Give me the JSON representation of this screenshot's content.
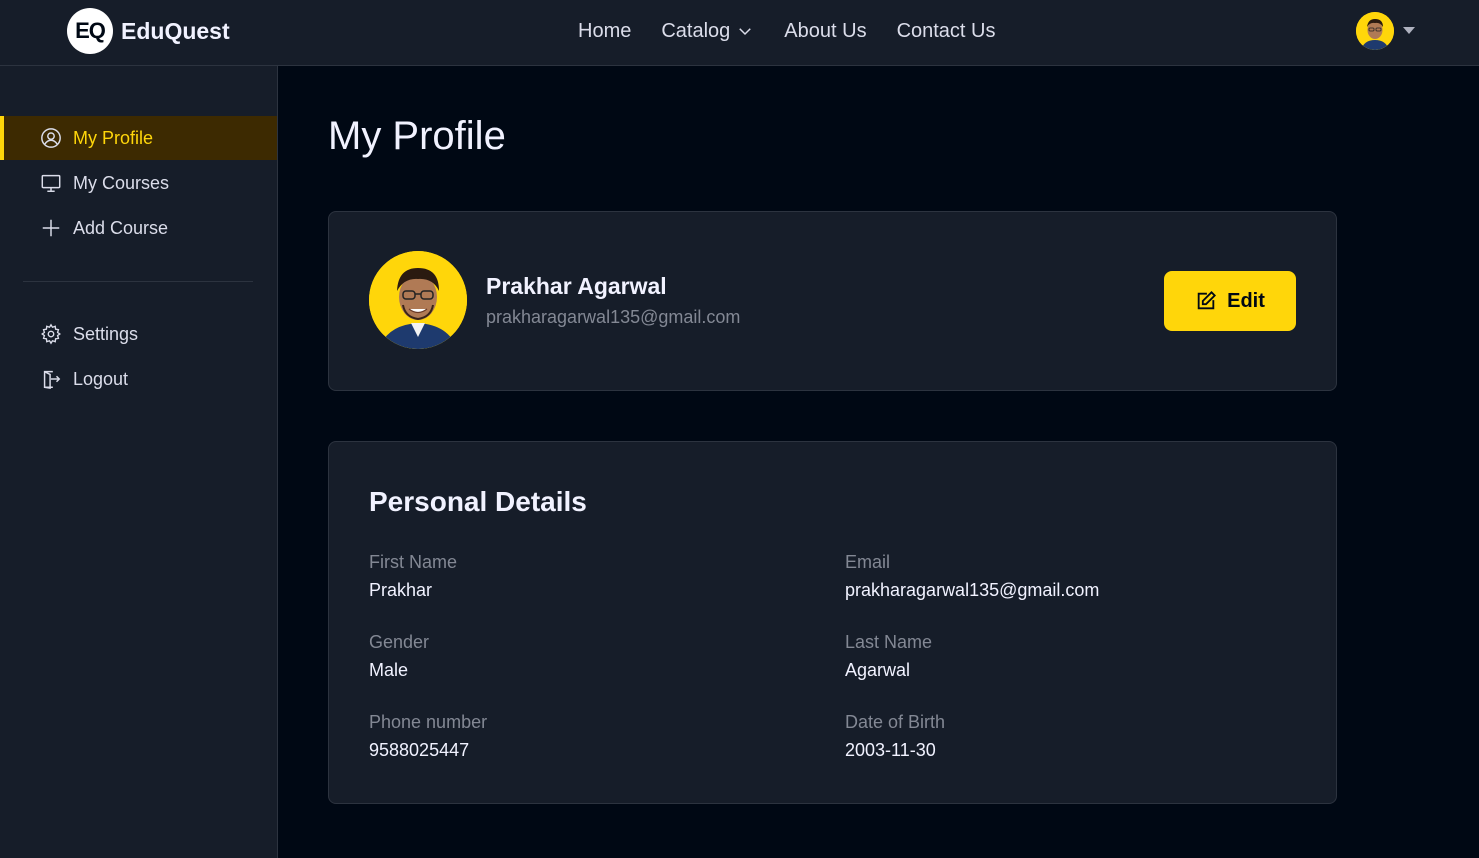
{
  "brand": {
    "logo_mark": "EQ",
    "name": "EduQuest"
  },
  "nav": {
    "links": [
      "Home",
      "Catalog",
      "About Us",
      "Contact Us"
    ],
    "catalog_icon": "chevron-down-icon",
    "avatar_icon": "user-avatar",
    "avatar_menu_icon": "caret-down-icon"
  },
  "sidebar": {
    "items": [
      {
        "label": "My Profile",
        "icon": "user-circle-icon",
        "active": true
      },
      {
        "label": "My Courses",
        "icon": "monitor-icon",
        "active": false
      },
      {
        "label": "Add Course",
        "icon": "plus-icon",
        "active": false
      }
    ],
    "bottom_items": [
      {
        "label": "Settings",
        "icon": "gear-icon"
      },
      {
        "label": "Logout",
        "icon": "logout-icon"
      }
    ]
  },
  "page": {
    "title": "My Profile"
  },
  "profile": {
    "name": "Prakhar Agarwal",
    "email": "prakharagarwal135@gmail.com",
    "edit_label": "Edit",
    "edit_icon": "edit-icon"
  },
  "details": {
    "title": "Personal Details",
    "fields": [
      {
        "label": "First Name",
        "value": "Prakhar"
      },
      {
        "label": "Email",
        "value": "prakharagarwal135@gmail.com"
      },
      {
        "label": "Gender",
        "value": "Male"
      },
      {
        "label": "Last Name",
        "value": "Agarwal"
      },
      {
        "label": "Phone number",
        "value": "9588025447"
      },
      {
        "label": "Date of Birth",
        "value": "2003-11-30"
      }
    ]
  },
  "colors": {
    "accent": "#FFD60A",
    "background": "#000814",
    "surface": "#161D29",
    "border": "#2C333F",
    "muted_text": "#838894",
    "active_bg": "#3D2A01"
  }
}
